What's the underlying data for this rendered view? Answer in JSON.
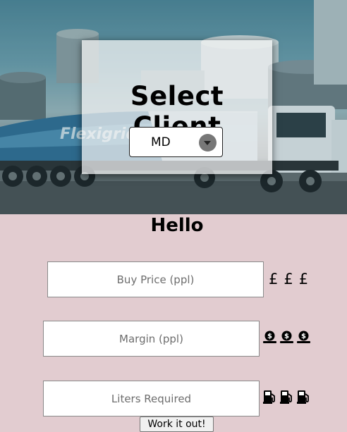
{
  "client": {
    "title": "Select Client",
    "selected": "MD"
  },
  "greeting": "Hello",
  "fields": {
    "buy_price": {
      "placeholder": "Buy Price (ppl)",
      "value": ""
    },
    "margin": {
      "placeholder": "Margin (ppl)",
      "value": ""
    },
    "liters": {
      "placeholder": "Liters Required",
      "value": ""
    }
  },
  "icons": {
    "currency": [
      "£",
      "£",
      "£"
    ],
    "margin": [
      "coin-icon",
      "coin-icon",
      "coin-icon"
    ],
    "liters": [
      "fuel-pump-icon",
      "fuel-pump-icon",
      "fuel-pump-icon"
    ]
  },
  "actions": {
    "calculate_label": "Work it out!"
  },
  "colors": {
    "page_background": "#e2ccd0"
  }
}
